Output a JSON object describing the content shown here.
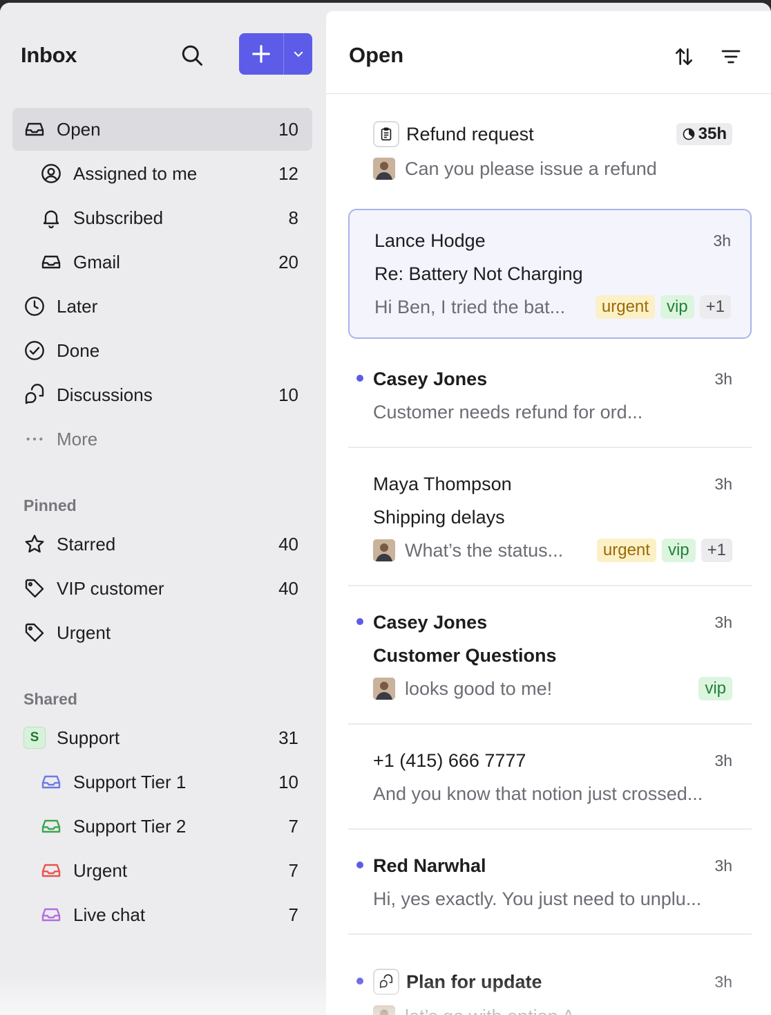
{
  "sidebar": {
    "title": "Inbox",
    "compose_icon": "plus-icon",
    "items": [
      {
        "label": "Open",
        "count": "10",
        "icon": "inbox-icon"
      },
      {
        "label": "Assigned to me",
        "count": "12",
        "icon": "user-circle-icon"
      },
      {
        "label": "Subscribed",
        "count": "8",
        "icon": "bell-icon"
      },
      {
        "label": "Gmail",
        "count": "20",
        "icon": "inbox-icon"
      },
      {
        "label": "Later",
        "count": "",
        "icon": "clock-icon"
      },
      {
        "label": "Done",
        "count": "",
        "icon": "check-circle-icon"
      },
      {
        "label": "Discussions",
        "count": "10",
        "icon": "chat-bubbles-icon"
      },
      {
        "label": "More",
        "count": "",
        "icon": "ellipsis-icon"
      }
    ],
    "pinned_label": "Pinned",
    "pinned": [
      {
        "label": "Starred",
        "count": "40",
        "icon": "star-icon"
      },
      {
        "label": "VIP customer",
        "count": "40",
        "icon": "tag-icon"
      },
      {
        "label": "Urgent",
        "count": "",
        "icon": "tag-icon"
      }
    ],
    "shared_label": "Shared",
    "shared": [
      {
        "label": "Support",
        "count": "31",
        "badge": "S"
      },
      {
        "label": "Support Tier 1",
        "count": "10",
        "color": "#6b79e8"
      },
      {
        "label": "Support Tier 2",
        "count": "7",
        "color": "#3aa64e"
      },
      {
        "label": "Urgent",
        "count": "7",
        "color": "#e8534f"
      },
      {
        "label": "Live chat",
        "count": "7",
        "color": "#b26ee0"
      }
    ]
  },
  "main": {
    "title": "Open",
    "conversations": [
      {
        "sender": "Refund request",
        "preview": "Can you please issue a refund",
        "sla": "35h"
      },
      {
        "sender": "Lance Hodge",
        "time": "3h",
        "subject": "Re: Battery Not Charging",
        "preview": "Hi Ben, I tried the bat...",
        "tags": [
          "urgent",
          "vip",
          "+1"
        ]
      },
      {
        "sender": "Casey Jones",
        "time": "3h",
        "preview": "Customer needs refund for ord..."
      },
      {
        "sender": "Maya Thompson",
        "time": "3h",
        "subject": "Shipping delays",
        "preview": "What’s the status...",
        "tags": [
          "urgent",
          "vip",
          "+1"
        ]
      },
      {
        "sender": "Casey Jones",
        "time": "3h",
        "subject": "Customer Questions",
        "preview": "looks good to me!",
        "tags": [
          "vip"
        ]
      },
      {
        "sender": "+1 (415) 666 7777",
        "time": "3h",
        "preview": "And you know that notion just crossed..."
      },
      {
        "sender": "Red Narwhal",
        "time": "3h",
        "preview": "Hi, yes exactly. You just need to unplu..."
      },
      {
        "sender": "Plan for update",
        "time": "3h",
        "preview": "let’s go with option A"
      }
    ]
  },
  "colors": {
    "accent": "#5c5ce8",
    "selected_border": "#aab3ee"
  }
}
